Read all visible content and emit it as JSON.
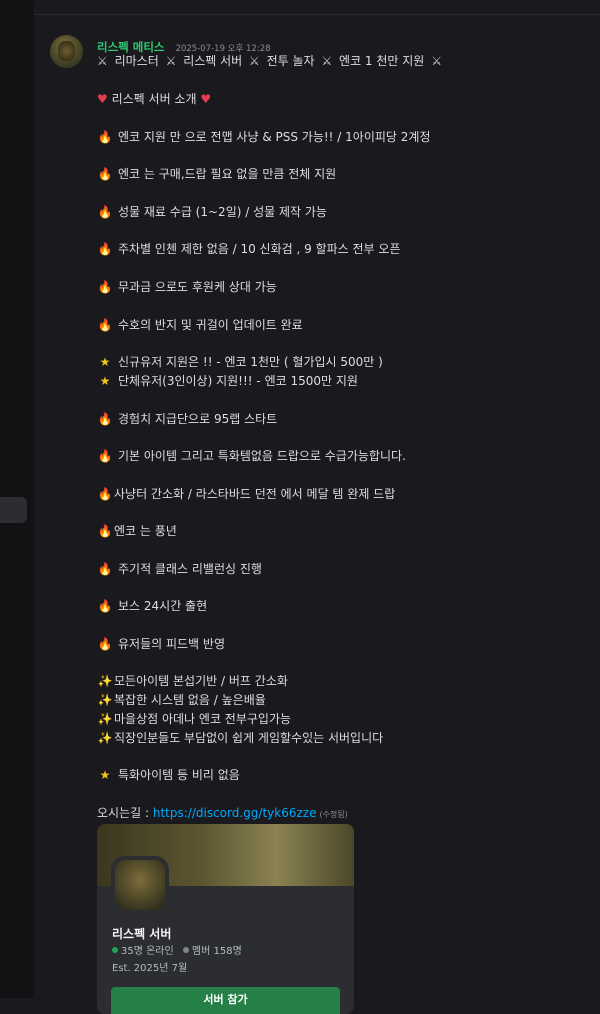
{
  "message": {
    "username": "리스펙 메티스",
    "timestamp": "2025-07-19 오후 12:28",
    "title_parts": [
      "리마스터",
      "리스펙 서버",
      "전투 놀자",
      "엔코 1 천만 지원"
    ],
    "intro": "리스펙 서버 소개",
    "fire_lines_a": [
      "엔코 지원 만 으로 전맵 사냥 & PSS 가능!! /  1아이피당 2계정",
      "엔코 는 구매,드랍 필요 없을 만큼 전체 지원",
      "성물 재료 수급 (1~2일)  / 성물 제작 가능",
      "주차별 인첸 제한 없음 / 10 신화검 , 9 할파스  전부 오픈",
      "무과금 으로도 후원케 상대 가능",
      "수호의 반지 및 귀걸이 업데이트 완료"
    ],
    "star_lines": [
      "신규유저 지원은  !! - 엔코 1천만 ( 혈가입시 500만 )",
      "단체유저(3인이상) 지원!!! - 엔코 1500만 지원"
    ],
    "fire_lines_b": [
      "경험치 지급단으로 95랩 스타트",
      "기본 아이템 그리고 특화템없음 드랍으로 수급가능합니다.",
      "사냥터 간소화 / 라스타바드 던전 에서 메달 템 완제 드랍",
      "엔코 는 풍년",
      "주기적 클래스 리밸런싱 진행",
      "보스 24시간 출현",
      "유저들의 피드백 반영"
    ],
    "sparkle_lines": [
      "모든아이템 본섭기반 / 버프 간소화",
      "복잡한 시스템 없음 / 높은배율",
      "마을상점 아데나 엔코 전부구입가능",
      "직장인분들도 부담없이 쉽게 게임할수있는 서버입니다"
    ],
    "final_star_line": "특화아이템 등 비리 없음",
    "link_label": "오시는길 :",
    "link_url": "https://discord.gg/tyk66zze",
    "edited_label": "(수정됨)"
  },
  "invite_card": {
    "server_name": "리스펙 서버",
    "online": "35명 온라인",
    "members": "멤버 158명",
    "established": "Est. 2025년 7월",
    "join_label": "서버 참가"
  },
  "icons": {
    "sword": "crossed-swords-icon",
    "heart": "red-heart-icon",
    "fire": "fire-icon",
    "star": "star-icon",
    "sparkle": "sparkles-icon"
  },
  "colors": {
    "username": "#2dc770",
    "link": "#00a8fc",
    "join_button": "#248046",
    "background": "#1a1a1e"
  }
}
